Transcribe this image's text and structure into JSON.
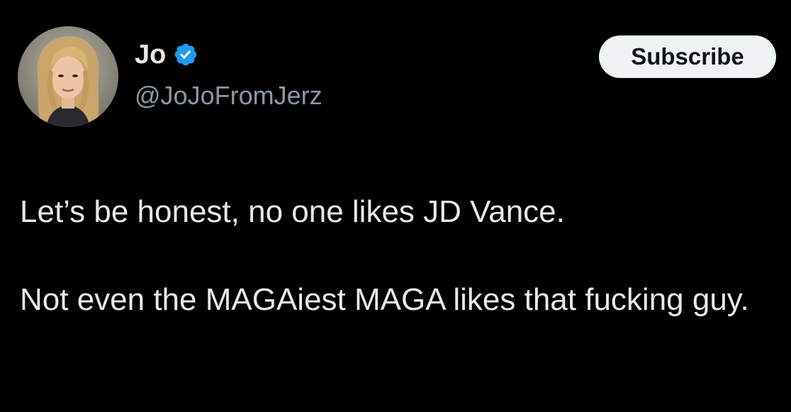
{
  "author": {
    "display_name": "Jo",
    "handle": "@JoJoFromJerz",
    "verified": true,
    "verified_color": "#1d9bf0",
    "avatar_icon": "profile-photo"
  },
  "actions": {
    "subscribe_label": "Subscribe"
  },
  "tweet": {
    "paragraphs": [
      "Let’s be honest, no one likes JD Vance.",
      "Not even the MAGAiest MAGA likes that fucking guy."
    ]
  },
  "colors": {
    "background": "#000000",
    "text": "#e7e9ea",
    "secondary_text": "#8b98a5",
    "button_bg": "#eff3f4",
    "button_text": "#0f1419"
  }
}
